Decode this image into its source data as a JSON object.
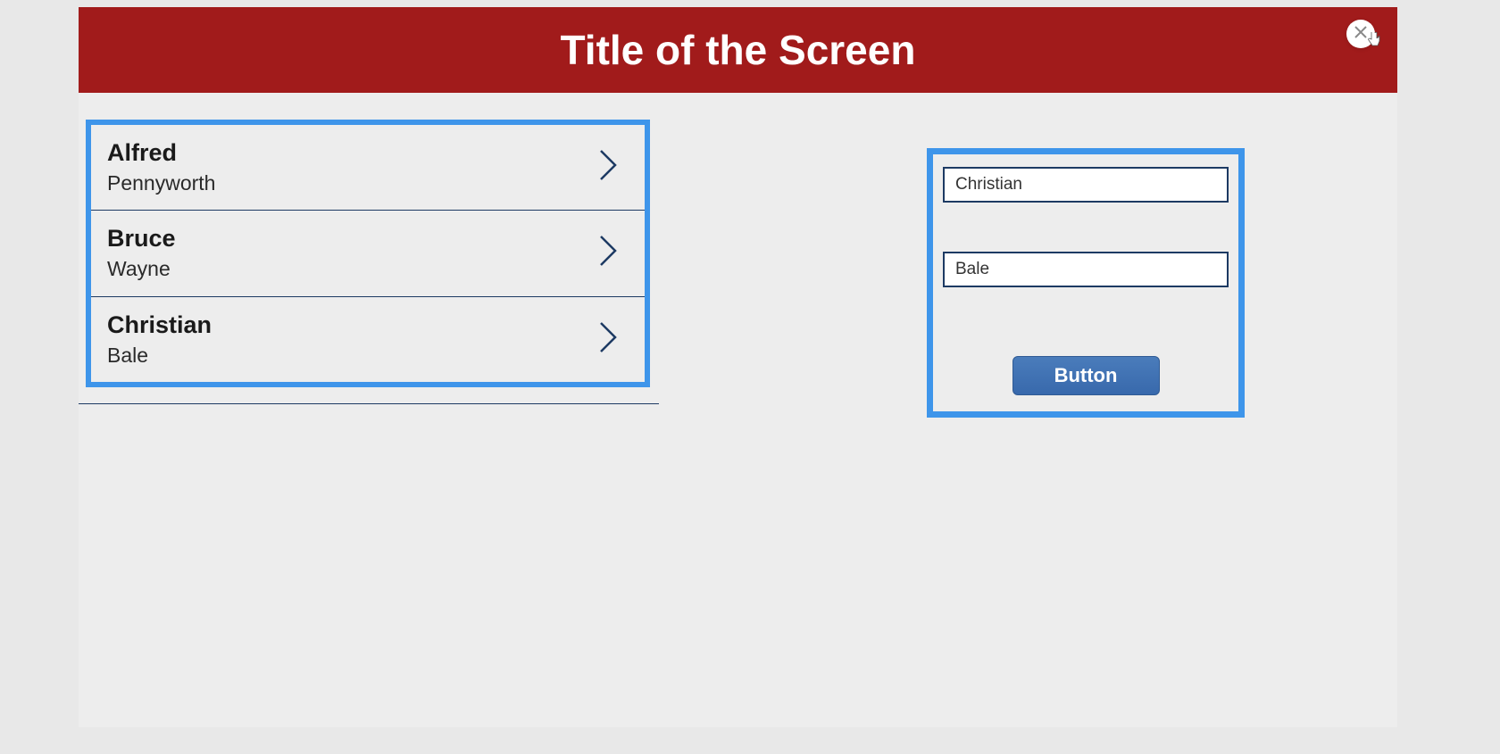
{
  "header": {
    "title": "Title of the Screen"
  },
  "list": {
    "items": [
      {
        "primary": "Alfred",
        "secondary": "Pennyworth"
      },
      {
        "primary": "Bruce",
        "secondary": "Wayne"
      },
      {
        "primary": "Christian",
        "secondary": "Bale"
      }
    ]
  },
  "form": {
    "input1_value": "Christian",
    "input2_value": "Bale",
    "button_label": "Button"
  },
  "colors": {
    "header_bg": "#a11b1b",
    "highlight_border": "#3e95ea",
    "input_border": "#1d3a63",
    "button_bg": "#3d72b5"
  }
}
